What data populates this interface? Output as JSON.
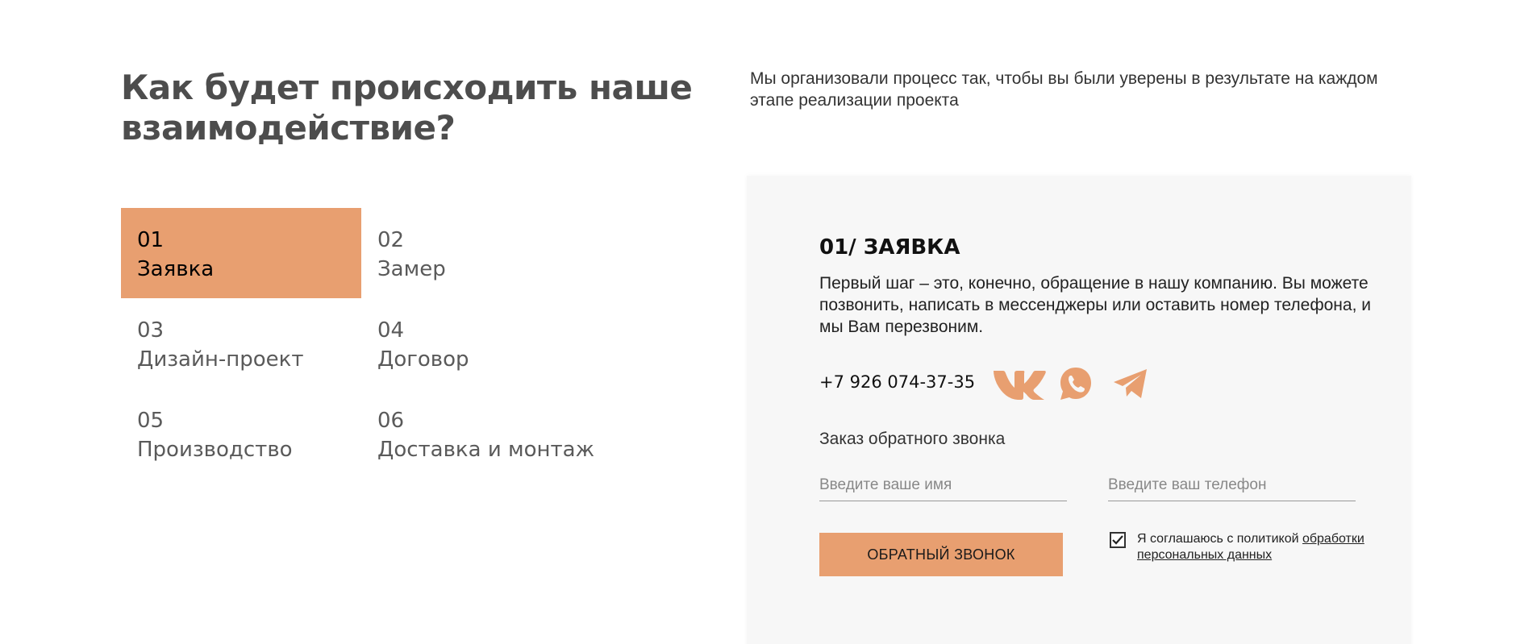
{
  "heading": {
    "title": "Как будет происходить наше взаимодействие?",
    "intro": "Мы организовали процесс так, чтобы вы были уверены в результате на каждом этапе реализации проекта"
  },
  "steps": [
    {
      "num": "01",
      "name": "Заявка",
      "active": true
    },
    {
      "num": "02",
      "name": "Замер",
      "active": false
    },
    {
      "num": "03",
      "name": "Дизайн-проект",
      "active": false
    },
    {
      "num": "04",
      "name": "Договор",
      "active": false
    },
    {
      "num": "05",
      "name": "Производство",
      "active": false
    },
    {
      "num": "06",
      "name": "Доставка и монтаж",
      "active": false
    }
  ],
  "panel": {
    "stage_title": "01/ ЗАЯВКА",
    "stage_text": "Первый шаг – это, конечно, обращение в нашу компанию. Вы можете позвонить, написать в мессенджеры или оставить номер телефона, и мы Вам перезвоним.",
    "phone": "+7 926 074-37-35",
    "social": [
      {
        "icon": "vk-icon"
      },
      {
        "icon": "whatsapp-icon"
      },
      {
        "icon": "telegram-icon"
      }
    ],
    "callback_label": "Заказ обратного звонка",
    "name_placeholder": "Введите ваше имя",
    "phone_placeholder": "Введите ваш телефон",
    "button_label": "ОБРАТНЫЙ ЗВОНОК",
    "consent_text": "Я соглашаюсь с политикой ",
    "consent_link": "обработки персональных данных",
    "checkbox_checked": true
  },
  "colors": {
    "accent": "#e89f70",
    "panel_bg": "#f7f7f7",
    "heading": "#4d4d4d"
  }
}
